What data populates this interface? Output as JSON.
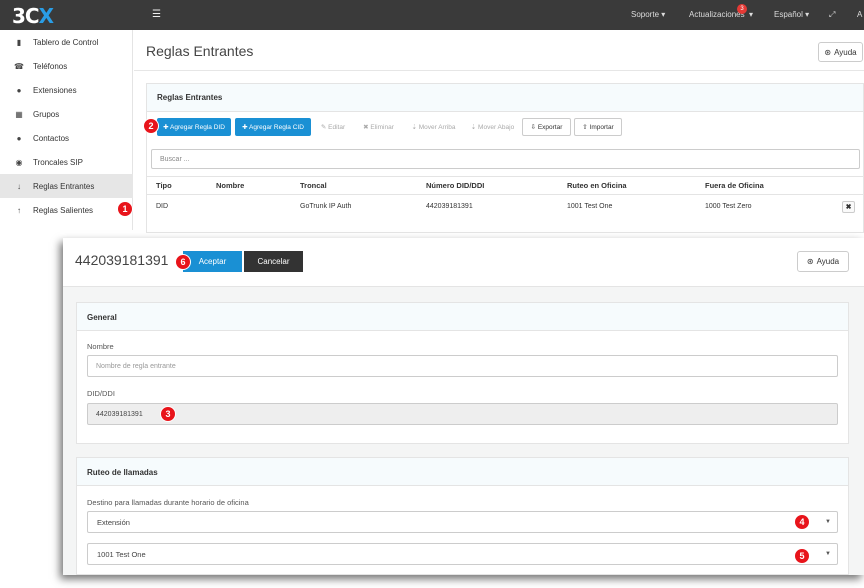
{
  "topbar": {
    "logo_main": "3C",
    "logo_x": "X",
    "menu_icon": "list-icon",
    "nav": [
      {
        "label": "Soporte"
      },
      {
        "label": "Actualizaciones",
        "badge": "3"
      },
      {
        "label": "Español"
      },
      {
        "label": "A"
      }
    ],
    "expand_icon": "expand-icon"
  },
  "sidebar": {
    "items": [
      {
        "label": "Tablero de Control",
        "icon": "bar-chart-icon",
        "glyph": "▮"
      },
      {
        "label": "Teléfonos",
        "icon": "phone-icon",
        "glyph": "☎"
      },
      {
        "label": "Extensiones",
        "icon": "user-icon",
        "glyph": "👤"
      },
      {
        "label": "Grupos",
        "icon": "grid-icon",
        "glyph": "▦"
      },
      {
        "label": "Contactos",
        "icon": "contact-icon",
        "glyph": "👤"
      },
      {
        "label": "Troncales SIP",
        "icon": "globe-icon",
        "glyph": "◉"
      },
      {
        "label": "Reglas Entrantes",
        "icon": "arrow-down-icon",
        "glyph": "↓",
        "active": true
      },
      {
        "label": "Reglas Salientes",
        "icon": "arrow-up-icon",
        "glyph": "↑"
      }
    ]
  },
  "main": {
    "title": "Reglas Entrantes",
    "help_label": "Ayuda",
    "panel_title": "Reglas Entrantes",
    "toolbar": [
      {
        "label": "✚ Agregar Regla DID",
        "style": "primary"
      },
      {
        "label": "✚ Agregar Regla CID",
        "style": "primary"
      },
      {
        "label": "✎ Editar",
        "style": "disabled"
      },
      {
        "label": "✖ Eliminar",
        "style": "disabled"
      },
      {
        "label": "⇣ Mover Arriba",
        "style": "disabled"
      },
      {
        "label": "⇣ Mover Abajo",
        "style": "disabled"
      },
      {
        "label": "⇩ Exportar",
        "style": "normal"
      },
      {
        "label": "⇧ Importar",
        "style": "normal"
      }
    ],
    "search_placeholder": "Buscar ...",
    "table": {
      "columns": [
        "Tipo",
        "Nombre",
        "Troncal",
        "Número DID/DDI",
        "Ruteo en Oficina",
        "Fuera de Oficina"
      ],
      "rows": [
        [
          "DID",
          "",
          "GoTrunk IP Auth",
          "442039181391",
          "1001 Test One",
          "1000 Test Zero"
        ]
      ],
      "delete_label": "✖"
    }
  },
  "dialog": {
    "title": "442039181391",
    "accept_label": "Aceptar",
    "cancel_label": "Cancelar",
    "help_label": "Ayuda",
    "general": {
      "title": "General",
      "name_label": "Nombre",
      "name_placeholder": "Nombre de regla entrante",
      "did_label": "DID/DDI",
      "did_value": "442039181391"
    },
    "routing": {
      "title": "Ruteo de llamadas",
      "dest_label": "Destino para llamadas durante horario de oficina",
      "dest_type": "Extensión",
      "dest_value": "1001 Test One"
    }
  },
  "markers": [
    "1",
    "2",
    "3",
    "4",
    "5",
    "6"
  ],
  "colors": {
    "accent": "#1a90d4",
    "topbar": "#3a3a3a",
    "marker": "#e8141b"
  }
}
